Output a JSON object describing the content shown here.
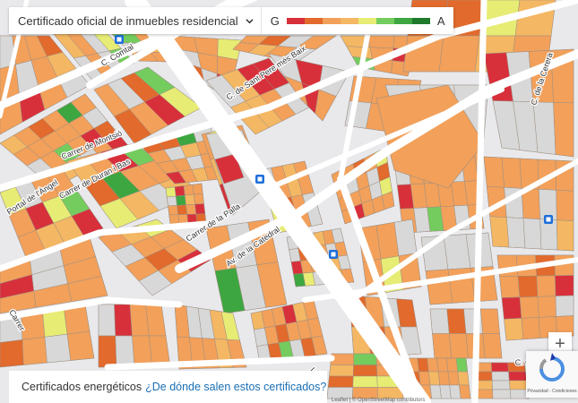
{
  "layer_select": {
    "label": "Certificado oficial de inmuebles residencial"
  },
  "legend": {
    "low_label": "G",
    "high_label": "A",
    "colors": [
      "#d7303b",
      "#e16a2c",
      "#f2a05a",
      "#f4b763",
      "#e7ec74",
      "#74cc5e",
      "#3ea640",
      "#1f7a2c"
    ]
  },
  "palette": {
    "background": "#e9e9ec",
    "street": "#ffffff",
    "building_none": "#d8d8d8",
    "outline": "#9d8f83"
  },
  "streets": [
    {
      "name": "C. Comtal"
    },
    {
      "name": "C. de Sant Pere més Baix"
    },
    {
      "name": "C. de la Cerera"
    },
    {
      "name": "Portal de l'Àngel"
    },
    {
      "name": "Carrer de Duran i Bas"
    },
    {
      "name": "Carrer de Montsió"
    },
    {
      "name": "Av. de la Catedral"
    },
    {
      "name": "Carrer de la Palla"
    },
    {
      "name": "Carrer"
    },
    {
      "name": "C. de la Font"
    },
    {
      "name": "Via Laietana"
    }
  ],
  "zoom": {
    "in_label": "+"
  },
  "recaptcha": {
    "text": "Privacidad - Condiciones"
  },
  "footer": {
    "label": "Certificados energéticos",
    "link": "¿De dónde salen estos certificados?"
  },
  "attribution": "Leaflet | © OpenStreetMap contributors"
}
